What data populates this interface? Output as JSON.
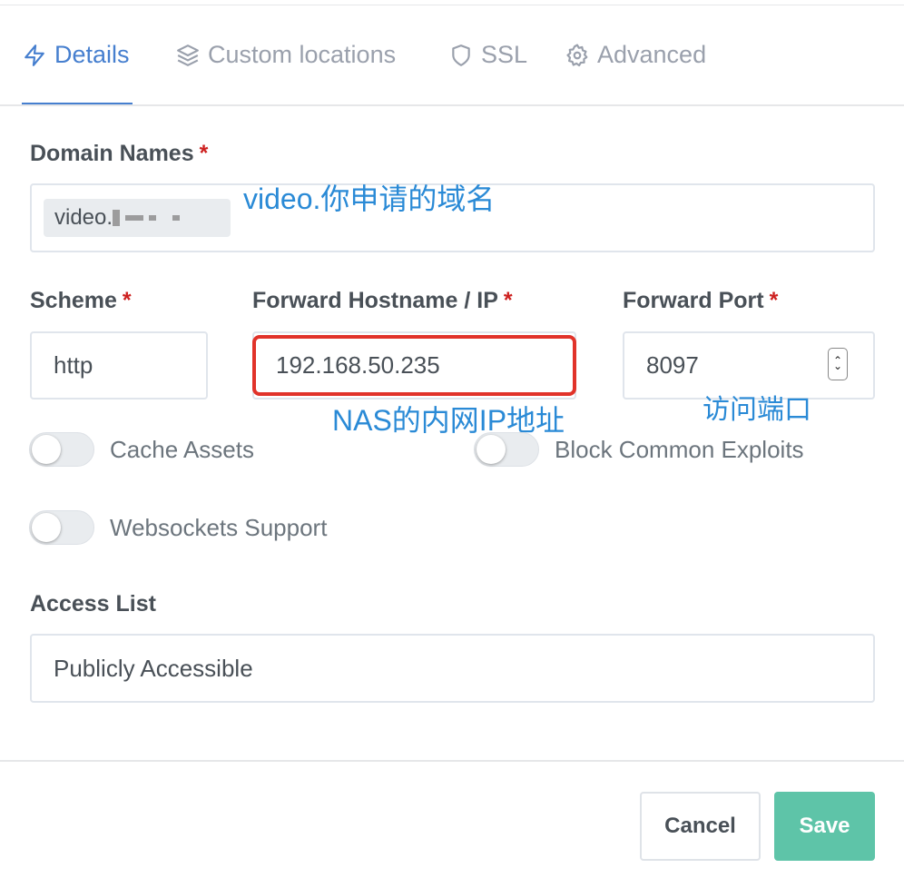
{
  "tabs": [
    {
      "label": "Details",
      "icon": "lightning-icon",
      "active": true
    },
    {
      "label": "Custom locations",
      "icon": "layers-icon",
      "active": false
    },
    {
      "label": "SSL",
      "icon": "shield-icon",
      "active": false
    },
    {
      "label": "Advanced",
      "icon": "gear-icon",
      "active": false
    }
  ],
  "form": {
    "domain_names": {
      "label": "Domain Names",
      "required_mark": "*",
      "tag_value": "video."
    },
    "scheme": {
      "label": "Scheme",
      "required_mark": "*",
      "value": "http"
    },
    "forward_host": {
      "label": "Forward Hostname / IP",
      "required_mark": "*",
      "value": "192.168.50.235"
    },
    "forward_port": {
      "label": "Forward Port",
      "required_mark": "*",
      "value": "8097",
      "stepper_up": "⌃",
      "stepper_down": "⌄"
    },
    "toggles": [
      {
        "label": "Cache Assets",
        "on": false
      },
      {
        "label": "Block Common Exploits",
        "on": false
      },
      {
        "label": "Websockets Support",
        "on": false
      }
    ],
    "access_list": {
      "label": "Access List",
      "value": "Publicly Accessible"
    }
  },
  "annotations": {
    "domain_note": "video.你申请的域名",
    "ip_note": "NAS的内网IP地址",
    "port_note": "访问端口"
  },
  "footer": {
    "cancel_label": "Cancel",
    "save_label": "Save"
  },
  "colors": {
    "accent": "#467fcf",
    "save": "#5ec4a8",
    "required": "#cd201f",
    "highlight": "#e1332a",
    "annotation": "#2a8ad6"
  }
}
